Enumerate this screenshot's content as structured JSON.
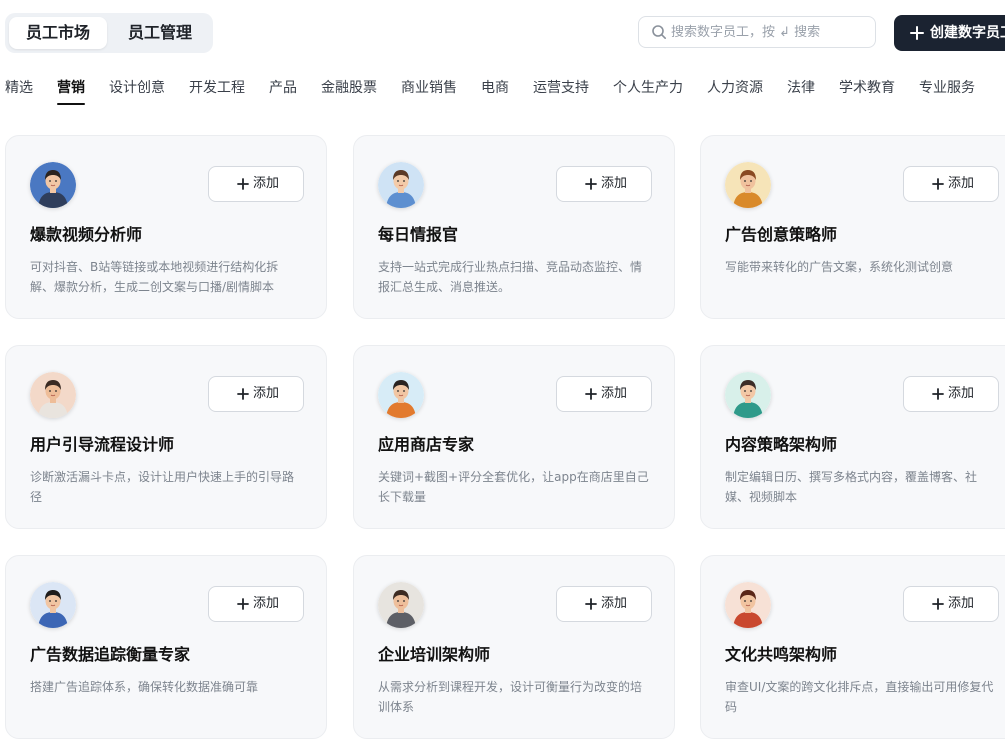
{
  "header": {
    "segments": [
      "员工市场",
      "员工管理"
    ],
    "search_placeholder": "搜索数字员工，按 ↲ 搜索",
    "create_label": "创建数字员工"
  },
  "tabs": [
    "精选",
    "营销",
    "设计创意",
    "开发工程",
    "产品",
    "金融股票",
    "商业销售",
    "电商",
    "运营支持",
    "个人生产力",
    "人力资源",
    "法律",
    "学术教育",
    "专业服务"
  ],
  "active_tab": "营销",
  "add_label": "添加",
  "cards": [
    {
      "title": "爆款视频分析师",
      "desc": "可对抖音、B站等链接或本地视频进行结构化拆解、爆款分析，生成二创文案与口播/剧情脚本",
      "icon": "avatar-man-suit-icon",
      "bg": "#4a78c2",
      "skin": "#f2c7a5",
      "hair": "#2b2420",
      "shirt": "#2f3e5c"
    },
    {
      "title": "每日情报官",
      "desc": "支持一站式完成行业热点扫描、竞品动态监控、情报汇总生成、消息推送。",
      "icon": "avatar-man-magnifier-icon",
      "bg": "#cfe3f5",
      "skin": "#f3cba9",
      "hair": "#5b3a26",
      "shirt": "#5d8fd0"
    },
    {
      "title": "广告创意策略师",
      "desc": "写能带来转化的广告文案，系统化测试创意",
      "icon": "avatar-woman-curly-icon",
      "bg": "#f6e4b8",
      "skin": "#f0c29e",
      "hair": "#8a4a22",
      "shirt": "#d98a2b"
    },
    {
      "title": "用户引导流程设计师",
      "desc": "诊断激活漏斗卡点，设计让用户快速上手的引导路径",
      "icon": "avatar-man-beard-icon",
      "bg": "#f3d9c9",
      "skin": "#eebd98",
      "hair": "#3a2a22",
      "shirt": "#e9e4de"
    },
    {
      "title": "应用商店专家",
      "desc": "关键词+截图+评分全套优化，让app在商店里自己长下载量",
      "icon": "avatar-woman-orange-icon",
      "bg": "#d7ecf7",
      "skin": "#f1c6a3",
      "hair": "#2a2320",
      "shirt": "#e27a2e"
    },
    {
      "title": "内容策略架构师",
      "desc": "制定编辑日历、撰写多格式内容，覆盖博客、社媒、视频脚本",
      "icon": "avatar-woman-teal-icon",
      "bg": "#d8f0ea",
      "skin": "#f2c8a6",
      "hair": "#3b2d27",
      "shirt": "#2f9a8a"
    },
    {
      "title": "广告数据追踪衡量专家",
      "desc": "搭建广告追踪体系，确保转化数据准确可靠",
      "icon": "avatar-man-glasses-icon",
      "bg": "#dbe6f5",
      "skin": "#f1c5a2",
      "hair": "#1f1c1b",
      "shirt": "#3c66b5"
    },
    {
      "title": "企业培训架构师",
      "desc": "从需求分析到课程开发，设计可衡量行为改变的培训体系",
      "icon": "avatar-man-vest-icon",
      "bg": "#e7e4df",
      "skin": "#eebf9b",
      "hair": "#3d2b22",
      "shirt": "#5d5f66"
    },
    {
      "title": "文化共鸣架构师",
      "desc": "审查UI/文案的跨文化排斥点，直接输出可用修复代码",
      "icon": "avatar-woman-red-icon",
      "bg": "#f7e1d6",
      "skin": "#f1c4a1",
      "hair": "#5a2618",
      "shirt": "#c9482f"
    }
  ]
}
